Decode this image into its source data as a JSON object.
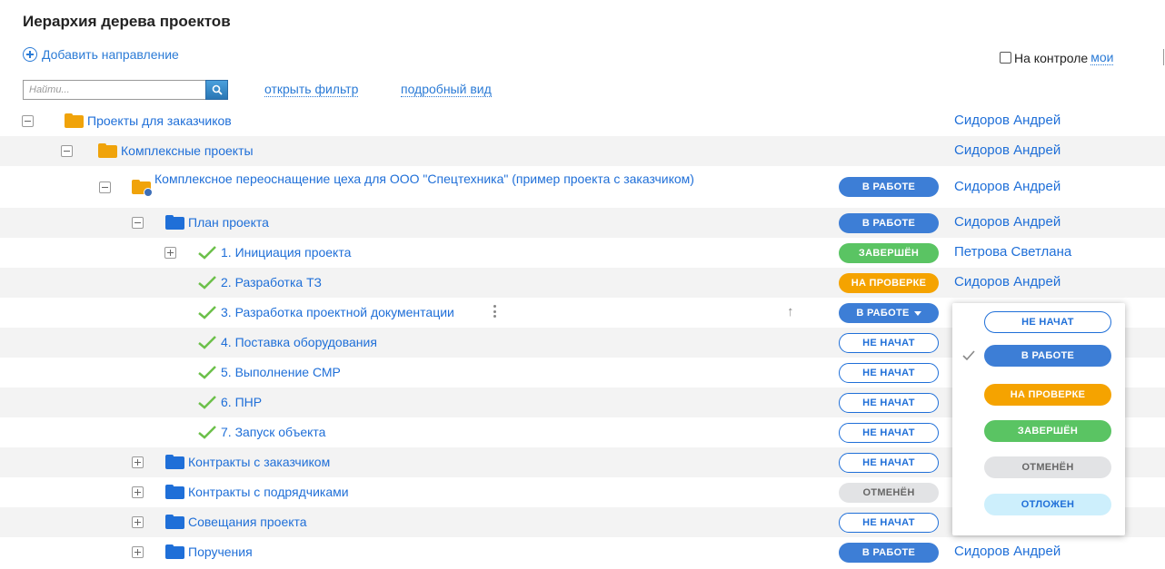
{
  "page": {
    "title": "Иерархия дерева проектов"
  },
  "toolbar": {
    "add_direction": "Добавить направление",
    "control_label": "На контроле",
    "mine_link": "мои",
    "search_placeholder": "Найти...",
    "open_filter": "открыть фильтр",
    "detailed_view": "подробный вид"
  },
  "statuses": {
    "not_started": "НЕ НАЧАТ",
    "in_progress": "В РАБОТЕ",
    "review": "НА ПРОВЕРКЕ",
    "done": "ЗАВЕРШЁН",
    "cancelled": "ОТМЕНЁН",
    "postponed": "ОТЛОЖЕН"
  },
  "colors": {
    "link": "#1f6fd8",
    "in_progress": "#3d7ed6",
    "done": "#5ac463",
    "review": "#f5a300",
    "cancelled": "#e2e3e5",
    "postponed": "#cdeffc",
    "folder_orange": "#f0a30a",
    "folder_blue": "#1f6fd8"
  },
  "tree": [
    {
      "label": "Проекты для заказчиков",
      "owner": "Сидоров Андрей",
      "icon": "orange-folder-icon",
      "expander": "minus"
    },
    {
      "label": "Комплексные проекты",
      "owner": "Сидоров Андрей",
      "icon": "orange-folder-icon",
      "expander": "minus"
    },
    {
      "label": "Комплексное переоснащение цеха для ООО \"Спецтехника\" (пример проекта с заказчиком)",
      "owner": "Сидоров Андрей",
      "status": "В РАБОТЕ",
      "icon": "client-folder-icon",
      "expander": "minus"
    },
    {
      "label": "План проекта",
      "owner": "Сидоров Андрей",
      "status": "В РАБОТЕ",
      "icon": "blue-folder-icon",
      "expander": "minus"
    },
    {
      "label": "1. Инициация проекта",
      "owner": "Петрова Светлана",
      "status": "ЗАВЕРШЁН",
      "icon": "check-icon",
      "expander": "plus"
    },
    {
      "label": "2. Разработка ТЗ",
      "owner": "Сидоров Андрей",
      "status": "НА ПРОВЕРКЕ",
      "icon": "check-icon"
    },
    {
      "label": "3. Разработка проектной документации",
      "owner": "",
      "status": "В РАБОТЕ",
      "icon": "check-icon"
    },
    {
      "label": "4. Поставка оборудования",
      "owner": "",
      "status": "НЕ НАЧАТ",
      "icon": "check-icon"
    },
    {
      "label": "5. Выполнение СМР",
      "owner": "",
      "status": "НЕ НАЧАТ",
      "icon": "check-icon"
    },
    {
      "label": "6. ПНР",
      "owner": "",
      "status": "НЕ НАЧАТ",
      "icon": "check-icon"
    },
    {
      "label": "7. Запуск объекта",
      "owner": "",
      "status": "НЕ НАЧАТ",
      "icon": "check-icon"
    },
    {
      "label": "Контракты с заказчиком",
      "owner": "",
      "status": "НЕ НАЧАТ",
      "icon": "blue-folder-icon",
      "expander": "plus"
    },
    {
      "label": "Контракты с подрядчиками",
      "owner": "",
      "status": "ОТМЕНЁН",
      "icon": "blue-folder-icon",
      "expander": "plus"
    },
    {
      "label": "Совещания проекта",
      "owner": "",
      "status": "НЕ НАЧАТ",
      "icon": "blue-folder-icon",
      "expander": "plus"
    },
    {
      "label": "Поручения",
      "owner": "Сидоров Андрей",
      "status": "В РАБОТЕ",
      "icon": "blue-folder-icon",
      "expander": "plus"
    }
  ],
  "dropdown": {
    "selected": "В РАБОТЕ",
    "options": [
      "НЕ НАЧАТ",
      "В РАБОТЕ",
      "НА ПРОВЕРКЕ",
      "ЗАВЕРШЁН",
      "ОТМЕНЁН",
      "ОТЛОЖЕН"
    ]
  }
}
